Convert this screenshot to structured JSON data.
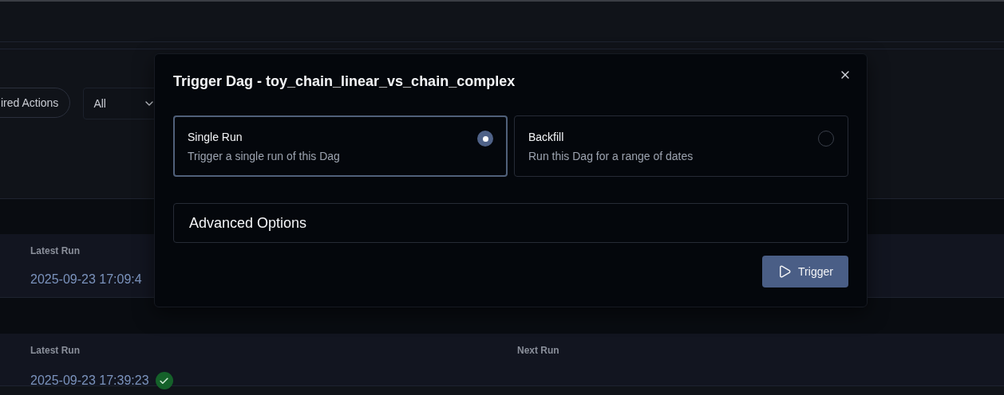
{
  "filters": [
    {
      "kind": "pill",
      "label": "ired Actions"
    },
    {
      "kind": "select",
      "value": "All"
    }
  ],
  "runs": [
    {
      "columns": [
        {
          "label": "Latest Run",
          "value": "2025-09-23 17:09:4"
        }
      ]
    },
    {
      "columns": [
        {
          "label": "Latest Run",
          "value": "2025-09-23 17:39:23",
          "success": true
        },
        {
          "label": "Next Run"
        }
      ]
    }
  ],
  "dialog": {
    "title": "Trigger Dag - toy_chain_linear_vs_chain_complex",
    "options": [
      {
        "label": "Single Run",
        "description": "Trigger a single run of this Dag",
        "selected": true
      },
      {
        "label": "Backfill",
        "description": "Run this Dag for a range of dates",
        "selected": false
      }
    ],
    "advanced": {
      "label": "Advanced Options"
    },
    "button": {
      "label": "Trigger"
    }
  }
}
